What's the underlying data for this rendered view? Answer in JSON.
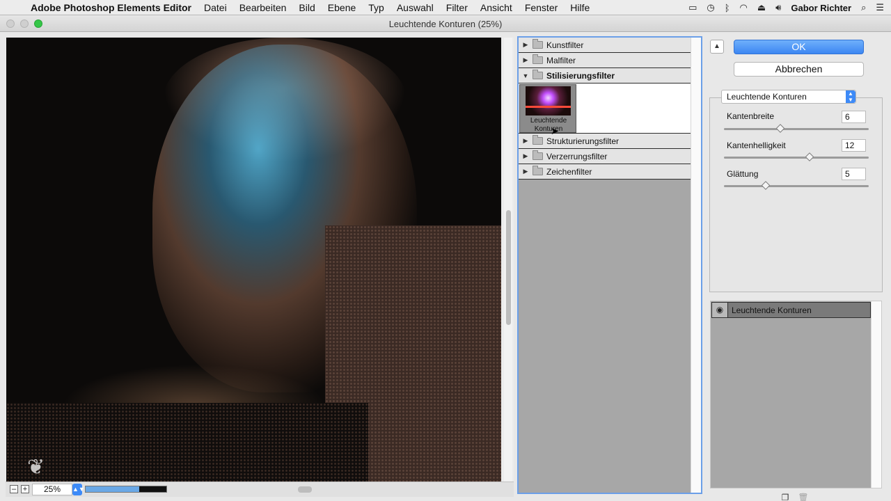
{
  "menubar": {
    "apple": "",
    "app_name": "Adobe Photoshop Elements Editor",
    "menus": [
      "Datei",
      "Bearbeiten",
      "Bild",
      "Ebene",
      "Typ",
      "Auswahl",
      "Filter",
      "Ansicht",
      "Fenster",
      "Hilfe"
    ],
    "user": "Gabor Richter"
  },
  "window": {
    "title": "Leuchtende Konturen (25%)"
  },
  "preview": {
    "zoom_value": "25%",
    "zoom_minus": "–",
    "zoom_plus": "+",
    "zoom_slider_fraction": 0.66
  },
  "filter_list": {
    "categories_top": [
      {
        "label": "Kunstfilter"
      },
      {
        "label": "Malfilter"
      }
    ],
    "open_category": {
      "label": "Stilisierungsfilter",
      "thumb_label": "Leuchtende Konturen"
    },
    "categories_bottom": [
      {
        "label": "Strukturierungsfilter"
      },
      {
        "label": "Verzerrungsfilter"
      },
      {
        "label": "Zeichenfilter"
      }
    ]
  },
  "buttons": {
    "ok": "OK",
    "cancel": "Abbrechen"
  },
  "settings": {
    "filter_select": "Leuchtende Konturen",
    "params": [
      {
        "label": "Kantenbreite",
        "value": "6",
        "fraction": 0.39
      },
      {
        "label": "Kantenhelligkeit",
        "value": "12",
        "fraction": 0.59
      },
      {
        "label": "Glättung",
        "value": "5",
        "fraction": 0.29
      }
    ]
  },
  "layers": {
    "items": [
      {
        "name": "Leuchtende Konturen"
      }
    ]
  },
  "colors": {
    "accent_blue": "#3d8af7",
    "list_border": "#6b9fe8"
  }
}
